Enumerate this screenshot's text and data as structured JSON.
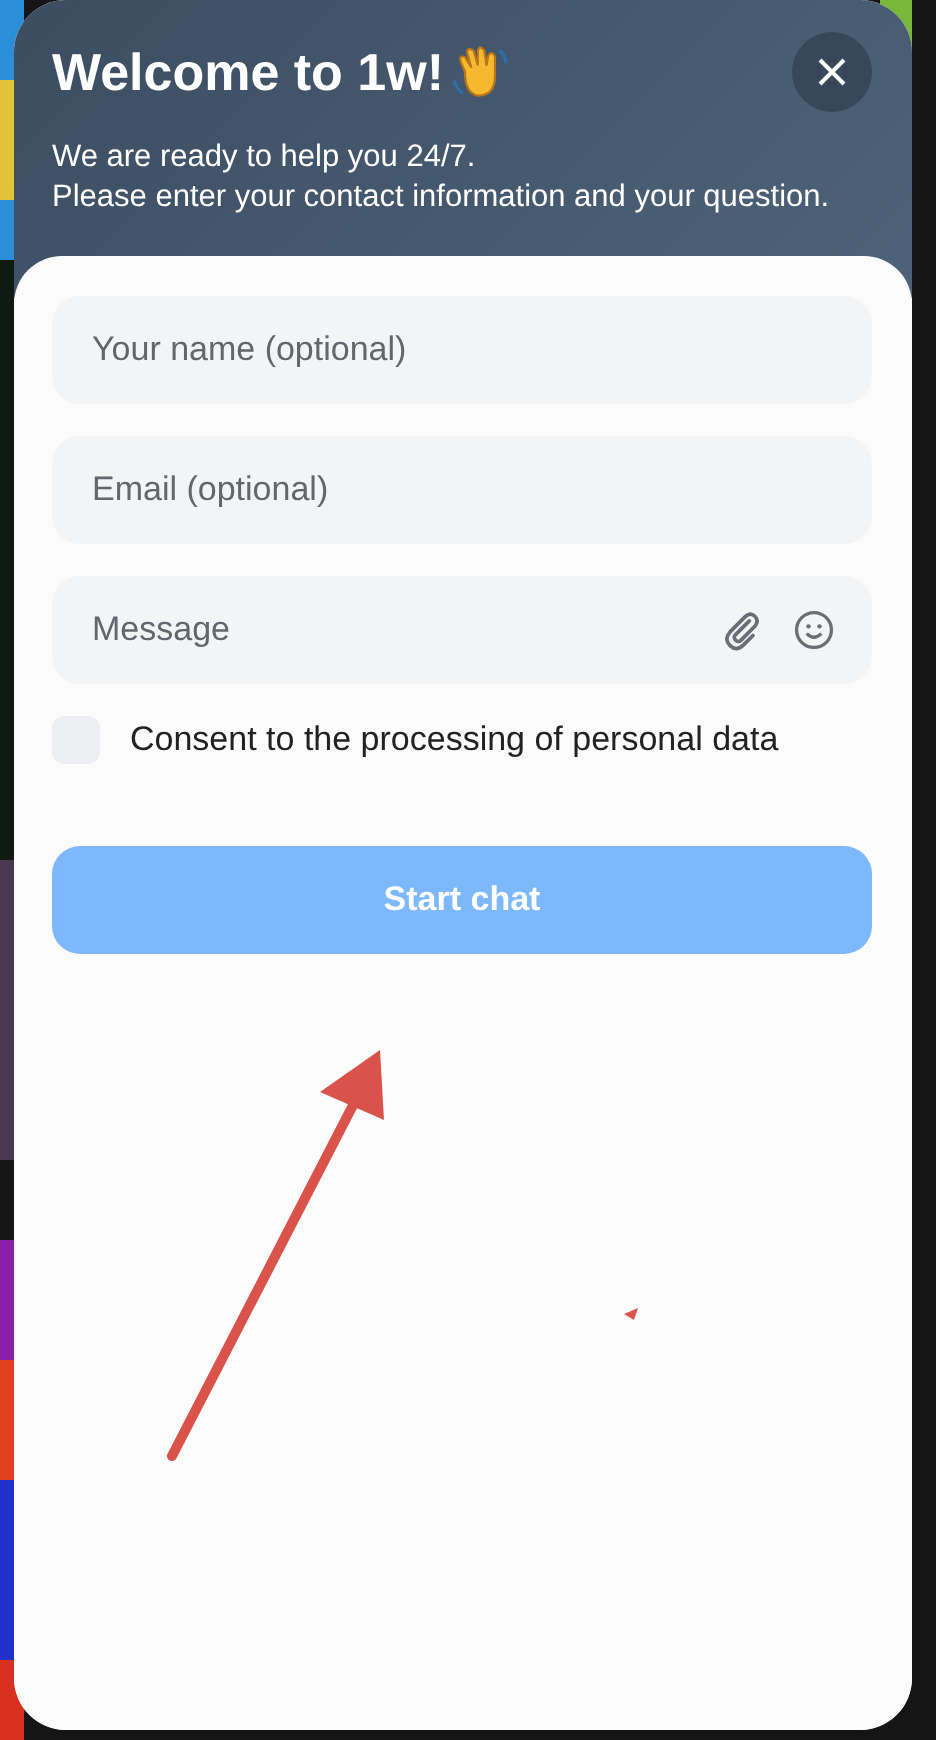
{
  "header": {
    "title": "Welcome to 1w!",
    "subtitle_lines": [
      "We are ready to help you 24/7.",
      "Please enter your contact information and your question."
    ]
  },
  "fields": [
    {
      "kind": "input",
      "placeholder": "Your name (optional)"
    },
    {
      "kind": "input",
      "placeholder": "Email (optional)"
    },
    {
      "kind": "message",
      "placeholder": "Message"
    }
  ],
  "consent": {
    "label": "Consent to the processing of personal data",
    "checked": false
  },
  "start_button": {
    "label": "Start chat",
    "disabled": true
  }
}
